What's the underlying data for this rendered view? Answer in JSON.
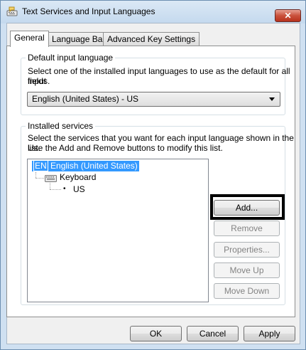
{
  "window": {
    "title": "Text Services and Input Languages",
    "close_glyph": "✕"
  },
  "tabs": [
    {
      "label": "General",
      "active": true
    },
    {
      "label": "Language Bar",
      "active": false
    },
    {
      "label": "Advanced Key Settings",
      "active": false
    }
  ],
  "default_input": {
    "legend": "Default input language",
    "description_line1": "Select one of the installed input languages to use as the default for all input",
    "description_line2": "fields.",
    "selected_value": "English (United States) - US"
  },
  "installed_services": {
    "legend": "Installed services",
    "description_line1": "Select the services that you want for each input language shown in the list.",
    "description_line2": "Use the Add and Remove buttons to modify this list.",
    "tree": {
      "language_code": "EN",
      "language_name": "English (United States)",
      "category": "Keyboard",
      "layout": "US",
      "bullet": "•"
    }
  },
  "side_buttons": {
    "add": "Add...",
    "remove": "Remove",
    "properties": "Properties...",
    "move_up": "Move Up",
    "move_down": "Move Down"
  },
  "footer_buttons": {
    "ok": "OK",
    "cancel": "Cancel",
    "apply": "Apply"
  },
  "colors": {
    "selection": "#3399ff",
    "accent_close": "#c9513b",
    "frame": "#cfe0f1"
  }
}
